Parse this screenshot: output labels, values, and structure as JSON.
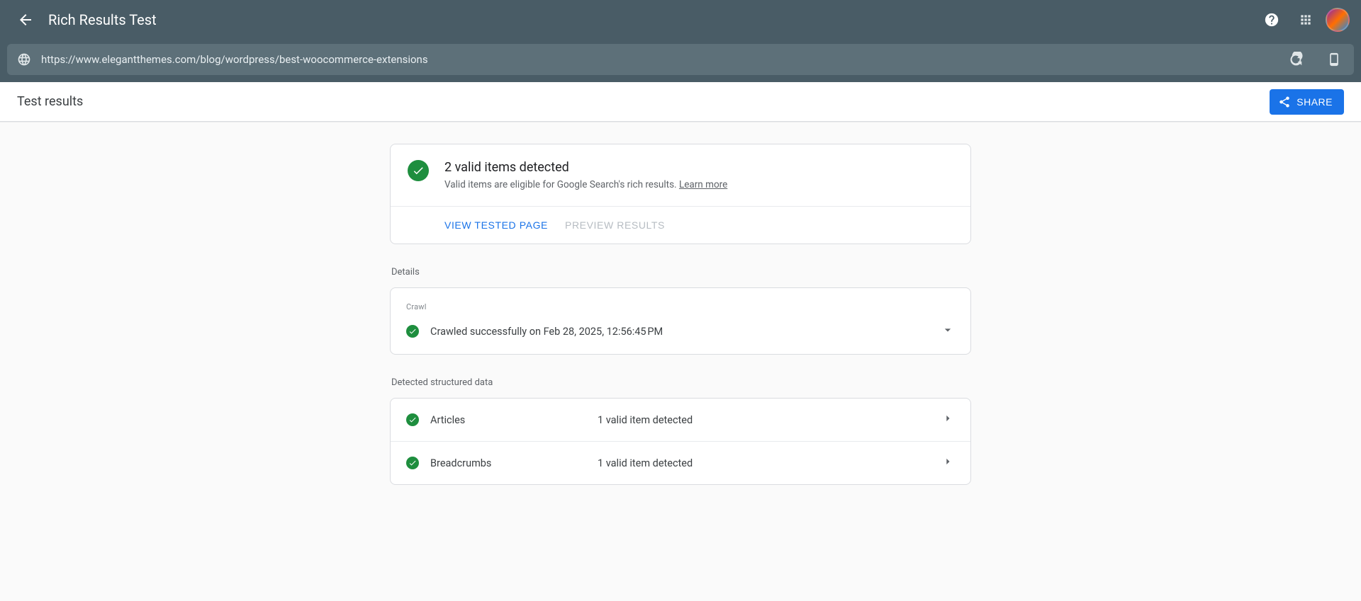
{
  "header": {
    "title": "Rich Results Test"
  },
  "urlbar": {
    "url": "https://www.elegantthemes.com/blog/wordpress/best-woocommerce-extensions"
  },
  "subheader": {
    "title": "Test results",
    "share_label": "SHARE"
  },
  "summary": {
    "title": "2 valid items detected",
    "subtitle_prefix": "Valid items are eligible for Google Search's rich results. ",
    "learn_more": "Learn more",
    "view_tested_label": "VIEW TESTED PAGE",
    "preview_results_label": "PREVIEW RESULTS"
  },
  "details_label": "Details",
  "crawl": {
    "heading": "Crawl",
    "message": "Crawled successfully on Feb 28, 2025, 12:56:45 PM"
  },
  "structured_label": "Detected structured data",
  "items": [
    {
      "name": "Articles",
      "count": "1 valid item detected"
    },
    {
      "name": "Breadcrumbs",
      "count": "1 valid item detected"
    }
  ]
}
